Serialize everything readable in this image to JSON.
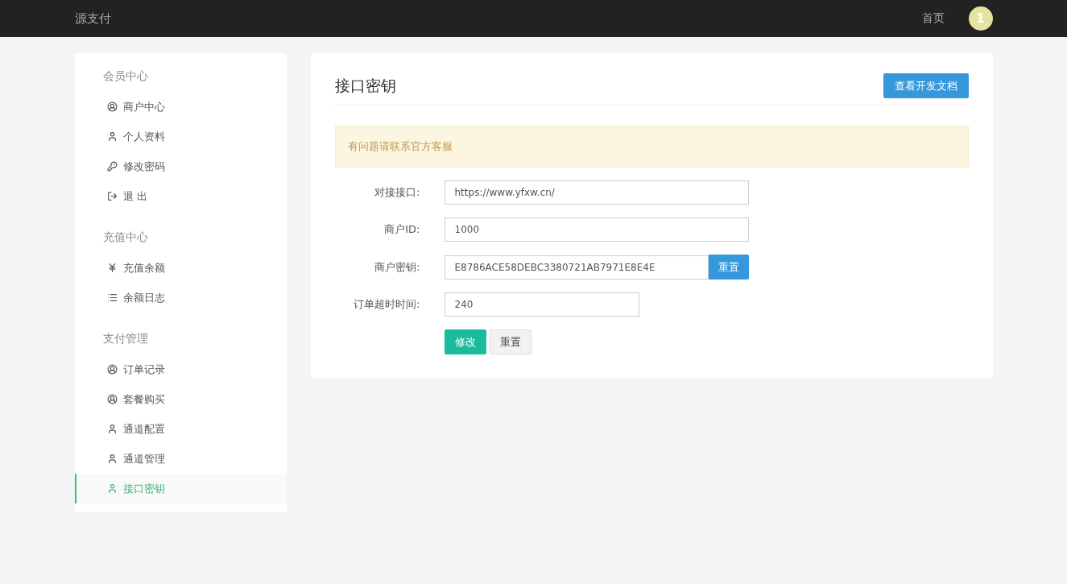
{
  "navbar": {
    "brand": "源支付",
    "links": [
      {
        "label": "首页"
      }
    ],
    "avatar": "1"
  },
  "sidebar": {
    "groups": [
      {
        "title": "会员中心",
        "items": [
          {
            "label": "商户中心",
            "kind": "account",
            "selected": false
          },
          {
            "label": "个人资料",
            "kind": "user",
            "selected": false
          },
          {
            "label": "修改密码",
            "kind": "key",
            "selected": false
          },
          {
            "label": "退 出",
            "kind": "logout",
            "selected": false
          }
        ]
      },
      {
        "title": "充值中心",
        "items": [
          {
            "label": "充值余额",
            "kind": "yen",
            "selected": false
          },
          {
            "label": "余额日志",
            "kind": "list",
            "selected": false
          }
        ]
      },
      {
        "title": "支付管理",
        "items": [
          {
            "label": "订单记录",
            "kind": "account",
            "selected": false
          },
          {
            "label": "套餐购买",
            "kind": "account",
            "selected": false
          },
          {
            "label": "通道配置",
            "kind": "user",
            "selected": false
          },
          {
            "label": "通道管理",
            "kind": "user",
            "selected": false
          },
          {
            "label": "接口密钥",
            "kind": "user",
            "selected": true
          }
        ]
      }
    ]
  },
  "panel": {
    "title": "接口密钥",
    "docs_button": "查看开发文档",
    "alert": "有问题请联系官方客服",
    "fields": [
      {
        "label": "对接接口:",
        "value": "https://www.yfxw.cn/",
        "kind": "text"
      },
      {
        "label": "商户ID:",
        "value": "1000",
        "kind": "text"
      },
      {
        "label": "商户密钥:",
        "value": "E8786ACE58DEBC3380721AB7971E8E4E",
        "kind": "with-button",
        "button": "重置"
      },
      {
        "label": "订单超时时间:",
        "value": "240",
        "kind": "short"
      }
    ],
    "actions": [
      {
        "label": "修改",
        "kind": "primary"
      },
      {
        "label": "重置",
        "kind": "default"
      }
    ]
  }
}
